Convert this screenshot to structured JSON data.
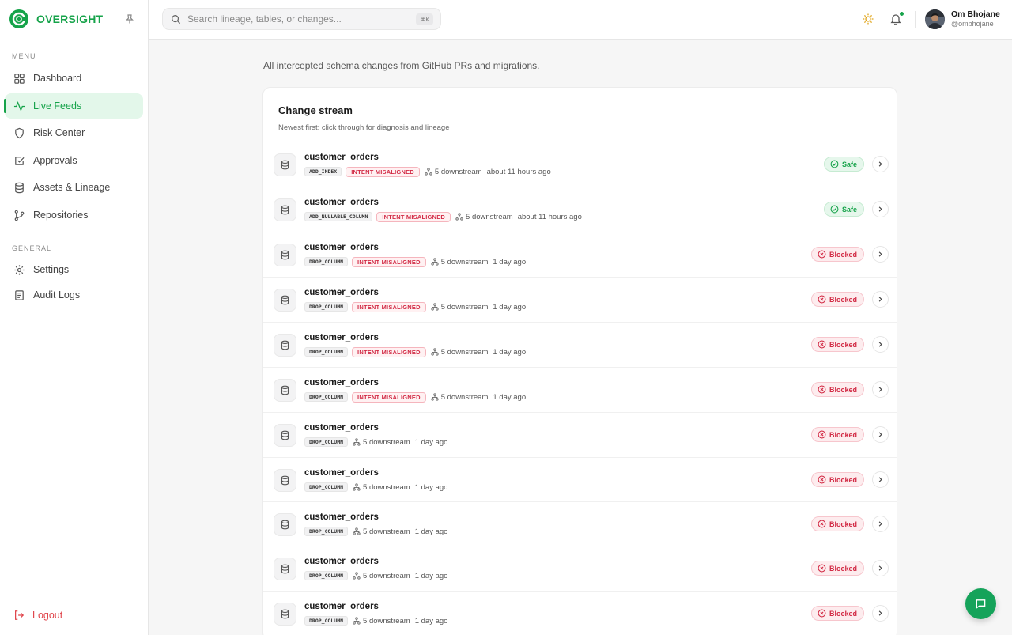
{
  "brand": {
    "name": "OVERSIGHT"
  },
  "sidebar": {
    "menu_label": "MENU",
    "general_label": "GENERAL",
    "menu_items": [
      {
        "label": "Dashboard",
        "icon": "grid-icon"
      },
      {
        "label": "Live Feeds",
        "icon": "activity-icon",
        "active": true
      },
      {
        "label": "Risk Center",
        "icon": "shield-icon"
      },
      {
        "label": "Approvals",
        "icon": "check-square-icon"
      },
      {
        "label": "Assets & Lineage",
        "icon": "database-icon"
      },
      {
        "label": "Repositories",
        "icon": "git-branch-icon"
      }
    ],
    "general_items": [
      {
        "label": "Settings",
        "icon": "gear-icon"
      },
      {
        "label": "Audit Logs",
        "icon": "logs-icon"
      }
    ],
    "logout_label": "Logout"
  },
  "header": {
    "search_placeholder": "Search lineage, tables, or changes...",
    "shortcut": "⌘K",
    "user": {
      "name": "Om Bhojane",
      "handle": "@ombhojane"
    }
  },
  "page": {
    "subtitle": "All intercepted schema changes from GitHub PRs and migrations."
  },
  "stream": {
    "title": "Change stream",
    "subtitle": "Newest first: click through for diagnosis and lineage",
    "rows": [
      {
        "table": "customer_orders",
        "change": "ADD_INDEX",
        "flag": "INTENT MISALIGNED",
        "downstream": "5 downstream",
        "time": "about 11 hours ago",
        "status": "Safe"
      },
      {
        "table": "customer_orders",
        "change": "ADD_NULLABLE_COLUMN",
        "flag": "INTENT MISALIGNED",
        "downstream": "5 downstream",
        "time": "about 11 hours ago",
        "status": "Safe"
      },
      {
        "table": "customer_orders",
        "change": "DROP_COLUMN",
        "flag": "INTENT MISALIGNED",
        "downstream": "5 downstream",
        "time": "1 day ago",
        "status": "Blocked"
      },
      {
        "table": "customer_orders",
        "change": "DROP_COLUMN",
        "flag": "INTENT MISALIGNED",
        "downstream": "5 downstream",
        "time": "1 day ago",
        "status": "Blocked"
      },
      {
        "table": "customer_orders",
        "change": "DROP_COLUMN",
        "flag": "INTENT MISALIGNED",
        "downstream": "5 downstream",
        "time": "1 day ago",
        "status": "Blocked"
      },
      {
        "table": "customer_orders",
        "change": "DROP_COLUMN",
        "flag": "INTENT MISALIGNED",
        "downstream": "5 downstream",
        "time": "1 day ago",
        "status": "Blocked"
      },
      {
        "table": "customer_orders",
        "change": "DROP_COLUMN",
        "flag": "",
        "downstream": "5 downstream",
        "time": "1 day ago",
        "status": "Blocked"
      },
      {
        "table": "customer_orders",
        "change": "DROP_COLUMN",
        "flag": "",
        "downstream": "5 downstream",
        "time": "1 day ago",
        "status": "Blocked"
      },
      {
        "table": "customer_orders",
        "change": "DROP_COLUMN",
        "flag": "",
        "downstream": "5 downstream",
        "time": "1 day ago",
        "status": "Blocked"
      },
      {
        "table": "customer_orders",
        "change": "DROP_COLUMN",
        "flag": "",
        "downstream": "5 downstream",
        "time": "1 day ago",
        "status": "Blocked"
      },
      {
        "table": "customer_orders",
        "change": "DROP_COLUMN",
        "flag": "",
        "downstream": "5 downstream",
        "time": "1 day ago",
        "status": "Blocked"
      }
    ]
  },
  "colors": {
    "accent": "#16a34a",
    "danger": "#d22b45"
  }
}
